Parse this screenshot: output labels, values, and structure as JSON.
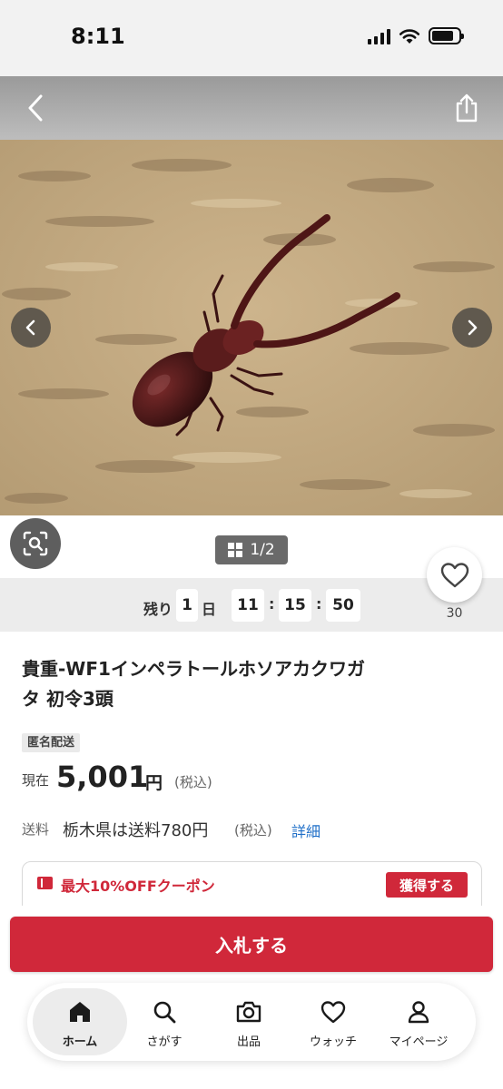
{
  "status_bar": {
    "time": "8:11"
  },
  "photo": {
    "alt": ""
  },
  "gallery": {
    "page": "1/2"
  },
  "countdown": {
    "remaining_label": "残り",
    "days": "1",
    "day_unit": "日",
    "hours": "11",
    "minutes": "15",
    "seconds": "50"
  },
  "watch": {
    "count": "30"
  },
  "item": {
    "title_line1": "貴重-WF1インペラトールホソアカクワガ",
    "title_line2": "タ 初令3頭",
    "badge": "匿名配送",
    "price_label": "現在",
    "price": "5,001",
    "price_unit": "円",
    "price_tax": "(税込)"
  },
  "shipping": {
    "label": "送料",
    "text": "栃木県は送料780円",
    "tax": "(税込)",
    "detail_link": "詳細"
  },
  "coupon": {
    "text": "最大10%OFFクーポン",
    "button": "獲得する",
    "accent": "#d0283a"
  },
  "bid": {
    "label": "入札する"
  },
  "nav": {
    "items": [
      {
        "label": "ホーム",
        "icon": "home-icon"
      },
      {
        "label": "さがす",
        "icon": "search-icon"
      },
      {
        "label": "出品",
        "icon": "camera-icon"
      },
      {
        "label": "ウォッチ",
        "icon": "heart-icon"
      },
      {
        "label": "マイページ",
        "icon": "person-icon"
      }
    ]
  }
}
